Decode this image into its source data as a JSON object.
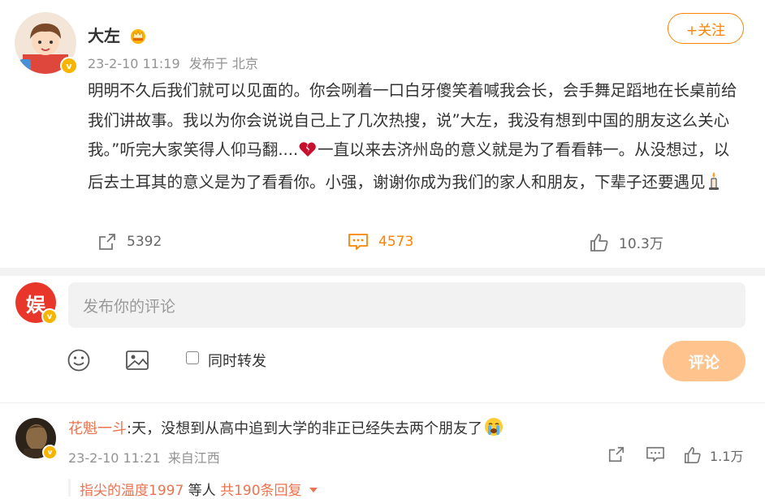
{
  "post": {
    "username": "大左",
    "verified_badge": "v",
    "crown_icon": "gold-crown-icon",
    "timestamp": "23-2-10 11:19",
    "source": "发布于 北京",
    "follow_label": "+关注",
    "text_part1": "明明不久后我们就可以见面的。你会咧着一口白牙傻笑着喊我会长，会手舞足蹈地在长桌前给我们讲故事。我以为你会说说自己上了几次热搜，说”大左，我没有想到中国的朋友这么关心我。”听完大家笑得人仰马翻....",
    "text_part2": "一直以来去济州岛的意义就是为了看看韩一。从没想过，以后去土耳其的意义是为了看看你。小强，谢谢你成为我们的家人和朋友，下辈子还要遇见",
    "broken_heart_icon": "broken-heart-icon",
    "candle_icon": "candle-icon",
    "repost_count": "5392",
    "comment_count": "4573",
    "like_count": "10.3万"
  },
  "composer": {
    "avatar_text": "娱",
    "placeholder": "发布你的评论",
    "emoji_icon": "emoji-icon",
    "image_icon": "image-icon",
    "repost_checkbox_label": "同时转发",
    "submit_label": "评论"
  },
  "comment": {
    "author": "花魁一斗",
    "text": ":天，没想到从高中追到大学的非正已经失去两个朋友了",
    "crying_icon": "crying-face-icon",
    "timestamp": "23-2-10 11:21",
    "source": "来自江西",
    "like_count": "1.1万",
    "reply_users": "指尖的温度1997",
    "reply_middle": "等人",
    "reply_total": "共190条回复"
  },
  "colors": {
    "accent": "#ff8200",
    "link": "#eb7350",
    "submit_disabled": "#ffc48e",
    "muted": "#939393"
  }
}
